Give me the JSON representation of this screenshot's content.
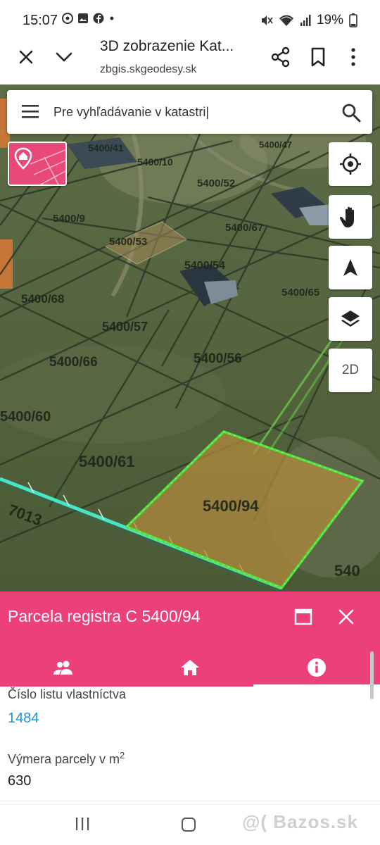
{
  "status_bar": {
    "time": "15:07",
    "battery": "19%",
    "icons": [
      "chrome-icon",
      "image-icon",
      "facebook-icon",
      "dot-icon",
      "mute-icon",
      "wifi-icon",
      "signal-icon",
      "battery-icon"
    ]
  },
  "browser": {
    "title": "3D zobrazenie Kat...",
    "url": "zbgis.skgeodesy.sk",
    "icons": [
      "close-icon",
      "chevron-down-icon",
      "share-icon",
      "bookmark-icon",
      "more-vert-icon"
    ]
  },
  "search": {
    "placeholder": "Pre vyhľadávanie v katastri|"
  },
  "map": {
    "controls": [
      "locate-icon",
      "hand-icon",
      "compass-icon",
      "layers-icon"
    ],
    "mode_button": "2D",
    "parcel_labels": [
      "5400/41",
      "5400/10",
      "5400/52",
      "5400/47",
      "5400/9",
      "5400/53",
      "5400/67",
      "5400/54",
      "5400/68",
      "5400/65",
      "5400/57",
      "5400/66",
      "5400/56",
      "5400/60",
      "5400/61",
      "5400/94",
      "7013",
      "540"
    ],
    "colors": {
      "selected_fill": "#b08a3e",
      "selected_border": "#4fe23a",
      "road": "#46e6c8",
      "parcel_line": "#2e3a2a"
    }
  },
  "panel": {
    "title": "Parcela registra C 5400/94",
    "accent": "#ec407a",
    "tabs": [
      "owners-tab",
      "parcel-tab",
      "info-tab"
    ],
    "active_tab": "info-tab",
    "fields": [
      {
        "label": "Číslo listu vlastníctva",
        "value": "1484"
      },
      {
        "label": "Výmera parcely v m",
        "superscript": "2",
        "value": "630"
      }
    ]
  },
  "nav": {
    "watermark": "@( Bazos.sk"
  }
}
